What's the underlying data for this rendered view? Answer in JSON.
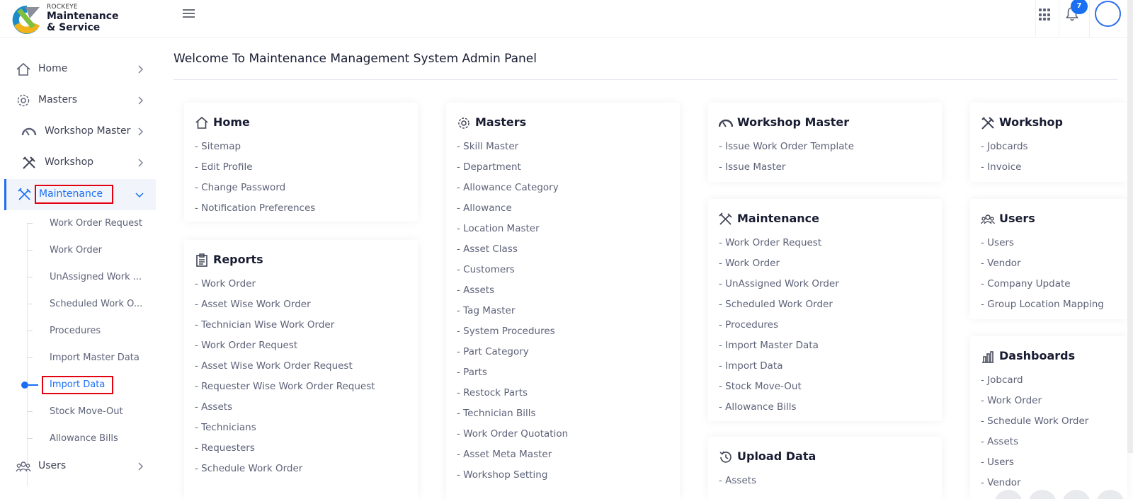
{
  "brand": {
    "small": "ROCKEYE",
    "line1": "Maintenance",
    "line2": "& Service"
  },
  "header": {
    "notification_count": "7"
  },
  "sidebar": {
    "items": [
      {
        "label": "Home"
      },
      {
        "label": "Masters"
      },
      {
        "label": "Workshop Master"
      },
      {
        "label": "Workshop"
      },
      {
        "label": "Maintenance"
      },
      {
        "label": "Users"
      }
    ],
    "maintenance_sub": [
      {
        "label": "Work Order Request"
      },
      {
        "label": "Work Order"
      },
      {
        "label": "UnAssigned Work ..."
      },
      {
        "label": "Scheduled Work O..."
      },
      {
        "label": "Procedures"
      },
      {
        "label": "Import Master Data"
      },
      {
        "label": "Import Data"
      },
      {
        "label": "Stock Move-Out"
      },
      {
        "label": "Allowance Bills"
      }
    ]
  },
  "page": {
    "title": "Welcome To Maintenance Management System Admin Panel"
  },
  "cards": {
    "home": {
      "title": "Home",
      "items": [
        "- Sitemap",
        "- Edit Profile",
        "- Change Password",
        "- Notification Preferences"
      ]
    },
    "reports": {
      "title": "Reports",
      "items": [
        "- Work Order",
        "- Asset Wise Work Order",
        "- Technician Wise Work Order",
        "- Work Order Request",
        "- Asset Wise Work Order Request",
        "- Requester Wise Work Order Request",
        "- Assets",
        "- Technicians",
        "- Requesters",
        "- Schedule Work Order"
      ]
    },
    "masters": {
      "title": "Masters",
      "items": [
        "- Skill Master",
        "- Department",
        "- Allowance Category",
        "- Allowance",
        "- Location Master",
        "- Asset Class",
        "- Customers",
        "- Assets",
        "- Tag Master",
        "- System Procedures",
        "- Part Category",
        "- Parts",
        "- Restock Parts",
        "- Technician Bills",
        "- Work Order Quotation",
        "- Asset Meta Master",
        "- Workshop Setting"
      ]
    },
    "workshop_master": {
      "title": "Workshop Master",
      "items": [
        "- Issue Work Order Template",
        "- Issue Master"
      ]
    },
    "maintenance": {
      "title": "Maintenance",
      "items": [
        "- Work Order Request",
        "- Work Order",
        "- UnAssigned Work Order",
        "- Scheduled Work Order",
        "- Procedures",
        "- Import Master Data",
        "- Import Data",
        "- Stock Move-Out",
        "- Allowance Bills"
      ]
    },
    "upload": {
      "title": "Upload Data",
      "items": [
        "- Assets"
      ]
    },
    "workshop": {
      "title": "Workshop",
      "items": [
        "- Jobcards",
        "- Invoice"
      ]
    },
    "users": {
      "title": "Users",
      "items": [
        "- Users",
        "- Vendor",
        "- Company Update",
        "- Group Location Mapping"
      ]
    },
    "dashboards": {
      "title": "Dashboards",
      "items": [
        "- Jobcard",
        "- Work Order",
        "- Schedule Work Order",
        "- Assets",
        "- Users",
        "- Vendor"
      ]
    }
  },
  "colors": {
    "accent": "#1b6ff3",
    "highlight": "#e3000f",
    "text": "#3f4254"
  },
  "icons": [
    "home-icon",
    "gear-icon",
    "gauge-icon",
    "tools-icon",
    "wrench-screwdriver-icon",
    "users-icon",
    "report-icon",
    "history-icon",
    "bar-chart-icon",
    "bell-icon",
    "apps-grid-icon"
  ]
}
